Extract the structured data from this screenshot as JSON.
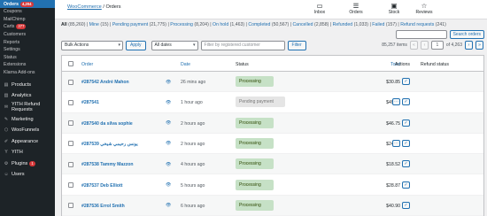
{
  "sidebar": {
    "items": [
      {
        "label": "Orders",
        "badge": "4,204",
        "type": "head"
      },
      {
        "label": "Coupons",
        "type": "sub"
      },
      {
        "label": "MailChimp",
        "type": "sub"
      },
      {
        "label": "Carts",
        "badge": "377",
        "type": "sub"
      },
      {
        "label": "Customers",
        "type": "sub"
      },
      {
        "label": "Reports",
        "type": "sub"
      },
      {
        "label": "Settings",
        "type": "sub"
      },
      {
        "label": "Status",
        "type": "sub"
      },
      {
        "label": "Extensions",
        "type": "sub"
      },
      {
        "label": "Klarna Add-ons",
        "type": "sub"
      }
    ],
    "menu": [
      {
        "label": "Products",
        "icon": "products-icon",
        "glyph": "▤"
      },
      {
        "label": "Analytics",
        "icon": "analytics-icon",
        "glyph": "▥"
      },
      {
        "label": "YITH Refund Requests",
        "icon": "refund-icon",
        "glyph": "✉"
      },
      {
        "label": "Marketing",
        "icon": "marketing-icon",
        "glyph": "✎"
      },
      {
        "label": "WooFunnels",
        "icon": "woofunnels-icon",
        "glyph": "⬡"
      },
      {
        "label": "Appearance",
        "icon": "appearance-icon",
        "glyph": "✐"
      },
      {
        "label": "YITH",
        "icon": "yith-icon",
        "glyph": "Y"
      },
      {
        "label": "Plugins",
        "icon": "plugins-icon",
        "glyph": "⚙",
        "badge": "1"
      },
      {
        "label": "Users",
        "icon": "users-icon",
        "glyph": "☺"
      }
    ]
  },
  "topbar": {
    "crumb_link": "WooCommerce",
    "crumb_sep": " / ",
    "crumb_current": "Orders",
    "buttons": [
      {
        "label": "Inbox",
        "glyph": "▭"
      },
      {
        "label": "Orders",
        "glyph": "☰"
      },
      {
        "label": "Stock",
        "glyph": "▣"
      },
      {
        "label": "Reviews",
        "glyph": "☆"
      }
    ]
  },
  "views": [
    {
      "label": "All",
      "count": "(85,260)",
      "current": true
    },
    {
      "label": "Mine",
      "count": "(15)"
    },
    {
      "label": "Pending payment",
      "count": "(21,775)"
    },
    {
      "label": "Processing",
      "count": "(8,204)"
    },
    {
      "label": "On hold",
      "count": "(1,463)"
    },
    {
      "label": "Completed",
      "count": "(50,567)"
    },
    {
      "label": "Cancelled",
      "count": "(2,858)"
    },
    {
      "label": "Refunded",
      "count": "(1,033)"
    },
    {
      "label": "Failed",
      "count": "(157)"
    },
    {
      "label": "Refund requests",
      "count": "(241)"
    }
  ],
  "search": {
    "button": "Search orders"
  },
  "filters": {
    "bulk": "Bulk Actions",
    "apply": "Apply",
    "dates": "All dates",
    "customer_placeholder": "Filter by registered customer",
    "filter": "Filter"
  },
  "pager": {
    "items": "85,257 items",
    "first": "«",
    "prev": "‹",
    "page": "1",
    "of": "of 4,263",
    "next": "›",
    "last": "»"
  },
  "table": {
    "headers": {
      "order": "Order",
      "date": "Date",
      "status": "Status",
      "total": "Total",
      "actions": "Actions",
      "refund": "Refund status"
    },
    "rows": [
      {
        "order": "#287542 André Mahon",
        "date": "26 mins ago",
        "status": "Processing",
        "total": "$30.85",
        "actions": 1
      },
      {
        "order": "#287541",
        "date": "1 hour ago",
        "status": "Pending payment",
        "total": "$49.59",
        "actions": 2
      },
      {
        "order": "#287540 da silva sophie",
        "date": "2 hours ago",
        "status": "Processing",
        "total": "$46.75",
        "actions": 1
      },
      {
        "order": "#287539 يونس رحيمي شيخي",
        "date": "2 hours ago",
        "status": "Processing",
        "total": "$24.90",
        "actions": 2
      },
      {
        "order": "#287538 Tammy Mazzon",
        "date": "4 hours ago",
        "status": "Processing",
        "total": "$18.52",
        "actions": 1
      },
      {
        "order": "#287537 Deb Elliott",
        "date": "5 hours ago",
        "status": "Processing",
        "total": "$28.87",
        "actions": 1
      },
      {
        "order": "#287536 Errol Smith",
        "date": "6 hours ago",
        "status": "Processing",
        "total": "$40.90",
        "actions": 1
      }
    ]
  }
}
